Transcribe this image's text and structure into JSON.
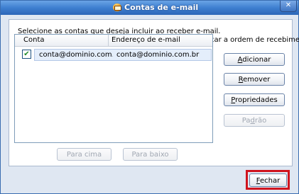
{
  "window": {
    "title": "Contas de e-mail",
    "close_glyph": "✕"
  },
  "instructions": {
    "line1": "Selecione as contas que deseja incluir ao receber e-mail.",
    "line2": "Utilize os botões 'Para cima' e 'Para baixo' para modificar a ordem de recebimento."
  },
  "accounts_list": {
    "columns": [
      "Conta",
      "Endereço de e-mail"
    ],
    "rows": [
      {
        "checked": true,
        "check_glyph": "✔",
        "account": "conta@dominio.com.br ...",
        "email": "conta@dominio.com.br"
      }
    ]
  },
  "side_buttons": {
    "add": {
      "prefix": "",
      "mnemonic": "A",
      "rest": "dicionar"
    },
    "remove": {
      "prefix": "",
      "mnemonic": "R",
      "rest": "emover"
    },
    "properties": {
      "prefix": "",
      "mnemonic": "P",
      "rest": "ropriedades"
    },
    "default": {
      "prefix": "Pa",
      "mnemonic": "d",
      "rest": "rão",
      "disabled": true
    }
  },
  "order_buttons": {
    "up": "Para cima",
    "down": "Para baixo"
  },
  "footer": {
    "close": {
      "mnemonic": "F",
      "rest": "echar"
    }
  },
  "colors": {
    "highlight": "#d0141e",
    "title_bar": "#3e7fd0"
  },
  "icons": {
    "title": "email-app-icon",
    "close": "close-icon",
    "check": "checkmark-icon"
  }
}
